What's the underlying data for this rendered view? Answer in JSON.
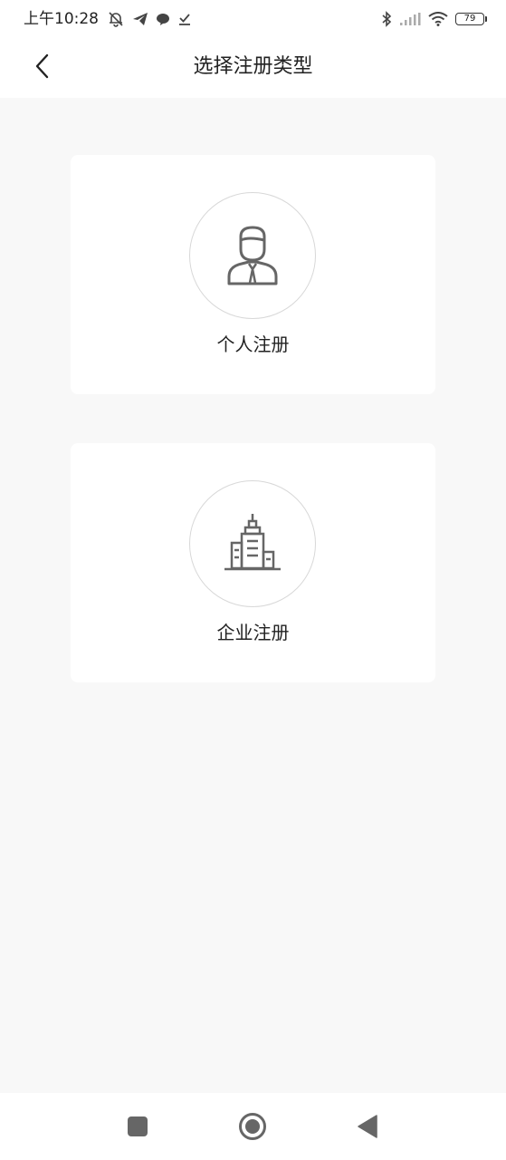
{
  "status_bar": {
    "time": "上午10:28",
    "battery_level": "79",
    "left_icons": [
      "notifications-off-icon",
      "telegram-icon",
      "chat-bubble-icon",
      "download-done-icon"
    ],
    "right_icons": [
      "bluetooth-icon",
      "signal-icon",
      "wifi-icon",
      "battery-icon"
    ]
  },
  "header": {
    "back_icon": "chevron-left-icon",
    "title": "选择注册类型"
  },
  "options": [
    {
      "label": "个人注册",
      "icon": "person-icon"
    },
    {
      "label": "企业注册",
      "icon": "building-icon"
    }
  ],
  "bottom_nav": {
    "icons": [
      "recent-apps-icon",
      "home-icon",
      "back-icon"
    ]
  },
  "colors": {
    "background": "#f8f8f8",
    "card": "#ffffff",
    "text": "#222222",
    "icon": "#666666",
    "circle_border": "#d8d8d8"
  }
}
